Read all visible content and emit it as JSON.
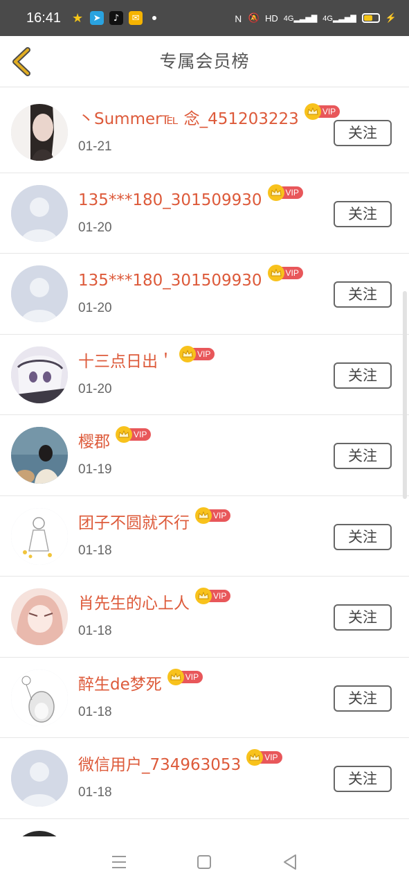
{
  "status_bar": {
    "time": "16:41",
    "network": "HD",
    "sig1": "4G",
    "sig2": "4G"
  },
  "header": {
    "title": "专属会员榜"
  },
  "vip_label": "VIP",
  "follow_label": "关注",
  "members": [
    {
      "name": "丶Summer℡ 念_451203223",
      "date": "01-21",
      "avatar": "photo-girl"
    },
    {
      "name": "135***180_301509930",
      "date": "01-20",
      "avatar": "default"
    },
    {
      "name": "135***180_301509930",
      "date": "01-20",
      "avatar": "default"
    },
    {
      "name": "十三点日出＇",
      "date": "01-20",
      "avatar": "anime"
    },
    {
      "name": "樱郡",
      "date": "01-19",
      "avatar": "photo-sea"
    },
    {
      "name": "团子不圆就不行",
      "date": "01-18",
      "avatar": "sketch-girl"
    },
    {
      "name": "肖先生的心上人",
      "date": "01-18",
      "avatar": "pink-illustration"
    },
    {
      "name": "醉生de梦死",
      "date": "01-18",
      "avatar": "totoro-sketch"
    },
    {
      "name": "微信用户_734963053",
      "date": "01-18",
      "avatar": "default"
    }
  ],
  "colors": {
    "name": "#dd5a3a",
    "vip_tag": "#e8575a",
    "crown": "#f8c21c",
    "back_arrow": "#d9a520"
  }
}
